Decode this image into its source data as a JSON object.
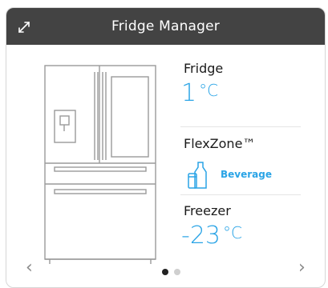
{
  "header": {
    "title": "Fridge Manager",
    "expand_icon": "expand-diagonal-arrows-icon"
  },
  "fridge": {
    "label": "Fridge",
    "temp_value": "1",
    "temp_unit": "°C"
  },
  "flexzone": {
    "label": "FlexZone™",
    "mode_icon": "beverage-bottle-can-icon",
    "mode_label": "Beverage"
  },
  "freezer": {
    "label": "Freezer",
    "temp_value": "-23",
    "temp_unit": "°C"
  },
  "pagination": {
    "prev_glyph": "‹",
    "next_glyph": "›",
    "pages": 2,
    "current_page": 1
  },
  "colors": {
    "header_bg": "#434343",
    "accent": "#2aa4e6",
    "dot_active": "#222222",
    "dot_inactive": "#cfcfcf"
  }
}
